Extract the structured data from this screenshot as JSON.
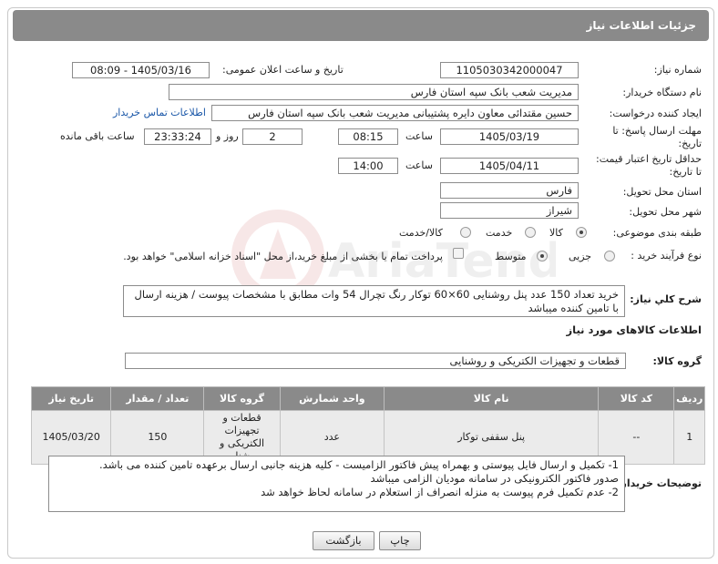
{
  "header": {
    "title": "جزئیات اطلاعات نیاز"
  },
  "fields": {
    "need_number_label": "شماره نیاز:",
    "need_number": "1105030342000047",
    "announce_label": "تاریخ و ساعت اعلان عمومی:",
    "announce_value": "1405/03/16 - 08:09",
    "buyer_org_label": "نام دستگاه خریدار:",
    "buyer_org": "مدیریت شعب بانک سپه استان فارس",
    "requester_label": "ایجاد کننده درخواست:",
    "requester": "حسین مقتدائی معاون  دایره پشتیبانی مدیریت شعب بانک سپه استان فارس",
    "contact_link": "اطلاعات تماس خریدار",
    "deadline_label_1": "مهلت ارسال پاسخ: تا",
    "deadline_label_2": "تاریخ:",
    "deadline_date": "1405/03/19",
    "time_label": "ساعت",
    "deadline_time": "08:15",
    "days_value": "2",
    "days_label": "روز و",
    "remaining_time": "23:33:24",
    "remaining_label": "ساعت باقی مانده",
    "validity_label_1": "حداقل تاریخ اعتبار قیمت:",
    "validity_label_2": "تا تاریخ:",
    "validity_date": "1405/04/11",
    "validity_time": "14:00",
    "province_label": "استان محل تحویل:",
    "province": "فارس",
    "city_label": "شهر محل تحویل:",
    "city": "شیراز",
    "category_label": "طبقه بندی موضوعی:",
    "category_options": [
      "کالا",
      "خدمت",
      "کالا/خدمت"
    ],
    "process_label": "نوع فرآیند خرید :",
    "process_options": [
      "جزیی",
      "متوسط"
    ],
    "payment_text": "پرداخت تمام یا بخشی از مبلغ خرید،از محل \"اسناد خزانه اسلامی\" خواهد بود."
  },
  "description": {
    "label": "شرح کلي نياز:",
    "text": "خرید تعداد 150 عدد پنل روشنایی 60×60 توکار رنگ تچرال 54 وات مطابق با مشخصات پیوست / هزینه ارسال با تامین کننده میباشد"
  },
  "goods_section": {
    "title": "اطلاعات کالاهای مورد نیاز",
    "group_label": "گروه کالا:",
    "group_value": "قطعات و تجهیزات الکتریکی و روشنایی"
  },
  "table": {
    "headers": [
      "ردیف",
      "کد کالا",
      "نام کالا",
      "واحد شمارش",
      "گروه کالا",
      "تعداد / مقدار",
      "تاریخ نیاز"
    ],
    "rows": [
      {
        "row": "1",
        "code": "--",
        "name": "پنل سقفی توکار",
        "unit": "عدد",
        "group": "قطعات و تجهیزات الکتریکی و روشنایی",
        "qty": "150",
        "date": "1405/03/20"
      }
    ]
  },
  "buyer_notes": {
    "label": "توضیحات خریدار:",
    "lines": [
      "1-  تکمیل و ارسال فایل پیوستی و بهمراه پیش فاکتور الزامیست - کلیه هزینه جانبی ارسال برعهده تامین کننده می باشد.",
      "صدور فاکتور الکترونیکی در سامانه مودیان الزامی میباشد",
      "2- عدم تکمیل فرم پیوست به منزله انصراف از استعلام در سامانه لحاظ خواهد شد"
    ]
  },
  "buttons": {
    "print": "چاپ",
    "back": "بازگشت"
  },
  "watermark": {
    "text": "AriaTender.net"
  },
  "colors": {
    "header_bg": "#8a8a8a",
    "link": "#1a57a8",
    "cell_bg": "#ebebeb"
  }
}
